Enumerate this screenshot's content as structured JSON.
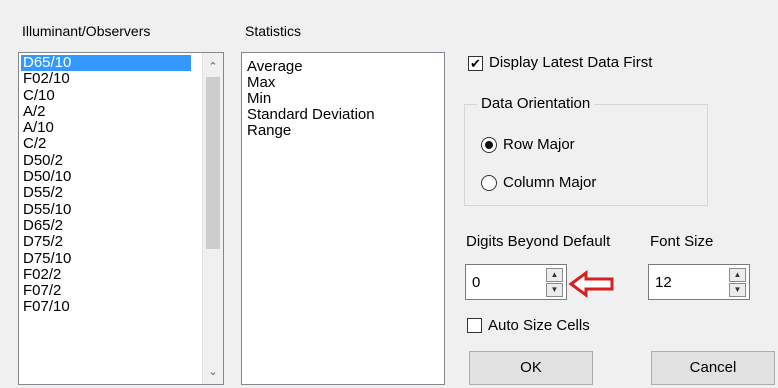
{
  "illuminants": {
    "title": "Illuminant/Observers",
    "items": [
      "D65/10",
      "F02/10",
      "C/10",
      "A/2",
      "A/10",
      "C/2",
      "D50/2",
      "D50/10",
      "D55/2",
      "D55/10",
      "D65/2",
      "D75/2",
      "D75/10",
      "F02/2",
      "F07/2",
      "F07/10"
    ],
    "selected": "D65/10"
  },
  "statistics": {
    "title": "Statistics",
    "items": [
      "Average",
      "Max",
      "Min",
      "Standard Deviation",
      "Range"
    ]
  },
  "display_latest": {
    "label": "Display Latest Data First",
    "checked": true
  },
  "orientation": {
    "title": "Data Orientation",
    "row_major": "Row Major",
    "column_major": "Column Major",
    "selected": "Row Major"
  },
  "digits": {
    "label": "Digits Beyond Default",
    "value": "0"
  },
  "font_size": {
    "label": "Font Size",
    "value": "12"
  },
  "auto_size": {
    "label": "Auto Size Cells",
    "checked": false
  },
  "buttons": {
    "ok": "OK",
    "cancel": "Cancel"
  },
  "annotation_color": "#d42020"
}
